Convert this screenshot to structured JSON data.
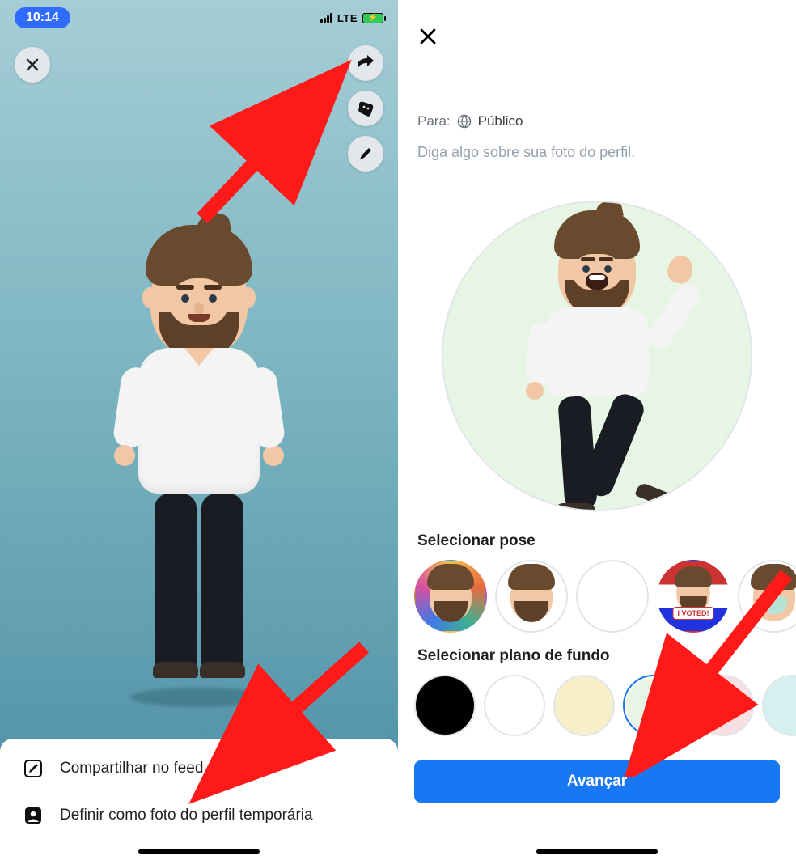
{
  "left": {
    "status": {
      "time": "10:14",
      "network": "LTE"
    },
    "icons": {
      "close": "close-icon",
      "share": "share-icon",
      "stickers": "stickers-icon",
      "edit": "pencil-icon"
    },
    "sheet": {
      "share_feed": {
        "icon": "compose-icon",
        "label": "Compartilhar no feed"
      },
      "set_profile": {
        "icon": "profile-frame-icon",
        "label": "Definir como foto do perfil temporária"
      }
    }
  },
  "right": {
    "close_icon": "close-icon",
    "audience": {
      "label": "Para:",
      "globe_icon": "globe-icon",
      "value": "Público"
    },
    "caption_placeholder": "Diga algo sobre sua foto do perfil.",
    "pose_section_title": "Selecionar pose",
    "poses": [
      {
        "name": "headshot-colorful",
        "selected": false
      },
      {
        "name": "headshot-white",
        "selected": false
      },
      {
        "name": "fullbody-wave",
        "selected": true
      },
      {
        "name": "i-voted",
        "selected": false,
        "badge": "I VOTED!"
      },
      {
        "name": "mask-face",
        "selected": false
      }
    ],
    "bg_section_title": "Selecionar plano de fundo",
    "backgrounds": [
      {
        "name": "black",
        "color": "#000000",
        "selected": false
      },
      {
        "name": "white",
        "color": "#ffffff",
        "selected": false
      },
      {
        "name": "cream",
        "color": "#f7efc7",
        "selected": false
      },
      {
        "name": "mint",
        "color": "#e6f5e4",
        "selected": true
      },
      {
        "name": "blush",
        "color": "#f7dfe3",
        "selected": false
      },
      {
        "name": "aqua",
        "color": "#d4f1ef",
        "selected": false
      }
    ],
    "primary_button": "Avançar"
  }
}
